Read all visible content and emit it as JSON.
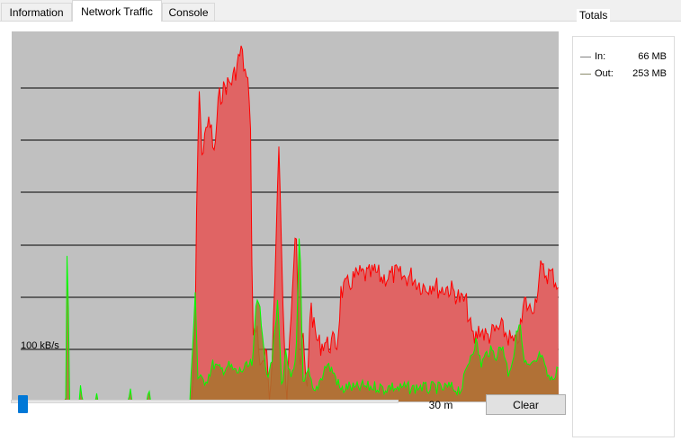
{
  "tabs": [
    {
      "label": "Information",
      "active": false
    },
    {
      "label": "Network Traffic",
      "active": true
    },
    {
      "label": "Console",
      "active": false
    }
  ],
  "graph": {
    "scale_label": "100 kB/s",
    "colors": {
      "background": "#c0c0c0",
      "gridline": "#000000",
      "out_line": "#ff0000",
      "out_fill": "#e06464",
      "in_line": "#00ff00",
      "in_fill": "#a8732e"
    }
  },
  "totals": {
    "title": "Totals",
    "rows": [
      {
        "label": "In:",
        "value": "66 MB",
        "color": "#808080"
      },
      {
        "label": "Out:",
        "value": "253 MB",
        "color": "#8b8b6b"
      }
    ]
  },
  "time_window": {
    "label": "30 m",
    "slider_value_fraction": 0.02
  },
  "clear_button": {
    "label": "Clear"
  }
}
